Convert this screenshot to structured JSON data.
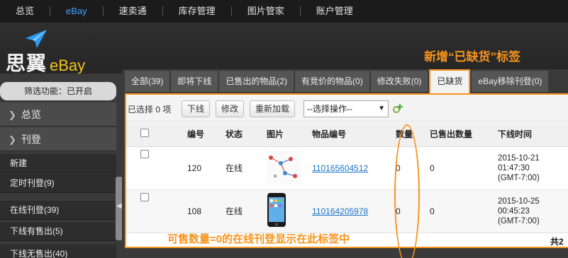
{
  "topnav": {
    "items": [
      {
        "label": "总览",
        "active": false
      },
      {
        "label": "eBay",
        "active": true
      },
      {
        "label": "速卖通",
        "active": false
      },
      {
        "label": "库存管理",
        "active": false
      },
      {
        "label": "图片管家",
        "active": false
      },
      {
        "label": "账户管理",
        "active": false
      }
    ]
  },
  "brand": {
    "cn": "思翼",
    "en": "eBay"
  },
  "annotations": {
    "top": "新增“已缺货”标签",
    "bottom": "可售数量=0的在线刊登显示在此标签中",
    "color": "#f7941d"
  },
  "sidebar": {
    "filter": "筛选功能：已开启",
    "heads": [
      "总览",
      "刊登"
    ],
    "items": [
      "新建",
      "定时刊登(9)",
      "在线刊登(39)",
      "下线有售出(5)",
      "下线无售出(40)"
    ]
  },
  "tabs": [
    {
      "label": "全部(39)",
      "active": false
    },
    {
      "label": "即将下线",
      "active": false
    },
    {
      "label": "已售出的物品(2)",
      "active": false
    },
    {
      "label": "有竞价的物品(0)",
      "active": false
    },
    {
      "label": "修改失败(0)",
      "active": false
    },
    {
      "label": "已缺货",
      "active": true
    },
    {
      "label": "eBay移除刊登(0)",
      "active": false
    }
  ],
  "toolbar": {
    "selected_count": "已选择 0 项",
    "offline_button": "下线",
    "edit_button": "修改",
    "reload_button": "重新加载",
    "select_placeholder": "--选择操作--"
  },
  "table": {
    "headers": [
      "",
      "编号",
      "状态",
      "图片",
      "物品编号",
      "数量",
      "已售出数量",
      "下线时间"
    ],
    "rows": [
      {
        "id": "120",
        "status": "在线",
        "item_no": "110165604512",
        "qty": "0",
        "sold": "0",
        "time1": "2015-10-21",
        "time2": "01:47:30",
        "tz": "(GMT-7:00)",
        "image": "flowchart-thumbnail"
      },
      {
        "id": "108",
        "status": "在线",
        "item_no": "110164205978",
        "qty": "0",
        "sold": "0",
        "time1": "2015-10-25",
        "time2": "00:45:23",
        "tz": "(GMT-7:00)",
        "image": "phone-thumbnail"
      }
    ]
  },
  "footer": {
    "total": "共2"
  }
}
